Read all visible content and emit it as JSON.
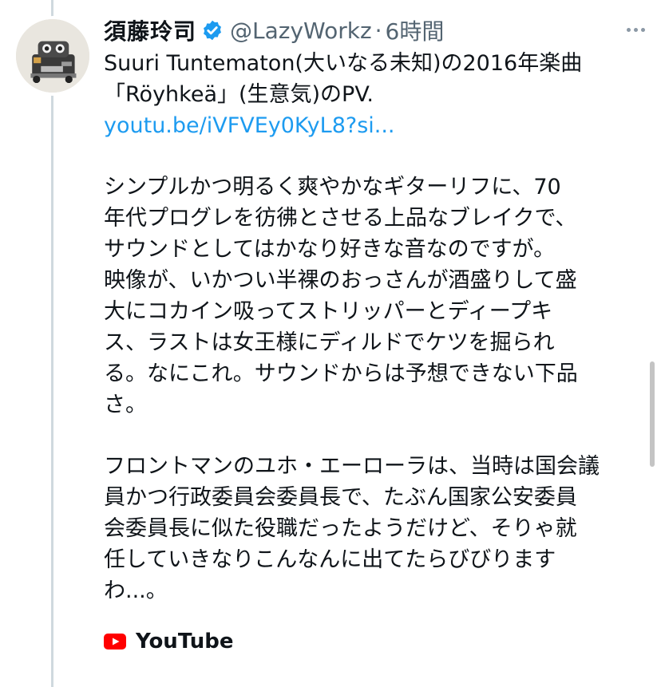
{
  "author": {
    "name": "須藤玲司",
    "handle": "@LazyWorkz",
    "separator": "·",
    "time": "6時間",
    "avatar_icon": "robot-avatar",
    "verified_icon": "verified-badge-icon"
  },
  "tweet": {
    "intro_lines": [
      "Suuri Tuntematon(大いなる未知)の2016年楽曲",
      "「Röyhkeä」(生意気)のPV."
    ],
    "link_text": "youtu.be/iVFVEy0KyL8?si...",
    "paragraph1_lines": [
      "シンプルかつ明るく爽やかなギターリフに、70",
      "年代プログレを彷彿とさせる上品なブレイクで、",
      "サウンドとしてはかなり好きな音なのですが。",
      "映像が、いかつい半裸のおっさんが酒盛りして盛",
      "大にコカイン吸ってストリッパーとディープキ",
      "ス、ラストは女王様にディルドでケツを掘られ",
      "る。なにこれ。サウンドからは予想できない下品",
      "さ。"
    ],
    "paragraph2_lines": [
      "フロントマンのユホ・エーローラは、当時は国会議",
      "員かつ行政委員会委員長で、たぶん国家公安委員",
      "会委員長に似た役職だったようだけど、そりゃ就",
      "任していきなりこんなんに出てたらびびりますわ...。"
    ]
  },
  "card": {
    "source_label": "YouTube",
    "source_icon": "youtube-icon"
  },
  "colors": {
    "link": "#1d9bf0",
    "secondary_text": "#536471",
    "verified": "#1d9bf0",
    "youtube": "#ff0000"
  }
}
